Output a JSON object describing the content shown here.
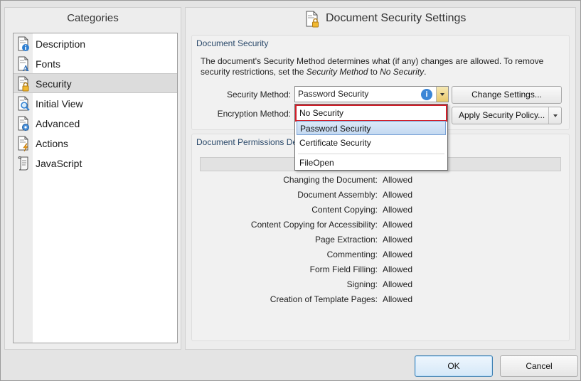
{
  "window": {
    "title": "Document Security Settings"
  },
  "categories": {
    "header": "Categories",
    "items": [
      {
        "label": "Description",
        "icon": "document-info-icon"
      },
      {
        "label": "Fonts",
        "icon": "document-font-icon"
      },
      {
        "label": "Security",
        "icon": "document-lock-icon",
        "selected": true
      },
      {
        "label": "Initial View",
        "icon": "document-view-icon"
      },
      {
        "label": "Advanced",
        "icon": "document-gear-icon"
      },
      {
        "label": "Actions",
        "icon": "document-lightning-icon"
      },
      {
        "label": "JavaScript",
        "icon": "script-scroll-icon"
      }
    ]
  },
  "security": {
    "group_title": "Document Security",
    "description_prefix": "The document's Security Method determines what (if any) changes are allowed. To remove security restrictions, set the ",
    "description_em1": "Security Method",
    "description_mid": " to ",
    "description_em2": "No Security",
    "description_suffix": ".",
    "method_label": "Security Method:",
    "method_value": "Password Security",
    "encryption_label": "Encryption Method:",
    "change_settings_button": "Change Settings...",
    "apply_policy_button": "Apply Security Policy..."
  },
  "dropdown": {
    "options": [
      "No Security",
      "Password Security",
      "Certificate Security",
      "FileOpen"
    ],
    "highlighted": "Password Security",
    "boxed": "No Security"
  },
  "permissions": {
    "group_title": "Document Permissions De",
    "rows": [
      {
        "label": "Changing the Document:",
        "value": "Allowed"
      },
      {
        "label": "Document Assembly:",
        "value": "Allowed"
      },
      {
        "label": "Content Copying:",
        "value": "Allowed"
      },
      {
        "label": "Content Copying for Accessibility:",
        "value": "Allowed"
      },
      {
        "label": "Page Extraction:",
        "value": "Allowed"
      },
      {
        "label": "Commenting:",
        "value": "Allowed"
      },
      {
        "label": "Form Field Filling:",
        "value": "Allowed"
      },
      {
        "label": "Signing:",
        "value": "Allowed"
      },
      {
        "label": "Creation of Template Pages:",
        "value": "Allowed"
      }
    ]
  },
  "footer": {
    "ok": "OK",
    "cancel": "Cancel"
  },
  "colors": {
    "accent": "#3b86d6",
    "highlight_box": "#d11f2a",
    "group_title": "#2b4a6b"
  }
}
